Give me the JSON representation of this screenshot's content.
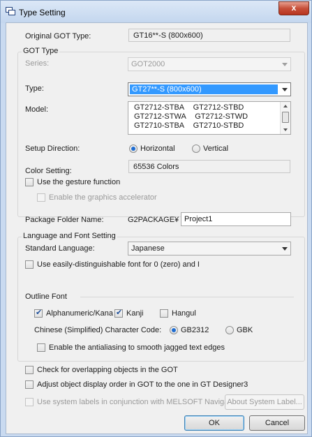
{
  "window": {
    "title": "Type Setting",
    "close_label": "x"
  },
  "original_got": {
    "label": "Original GOT Type:",
    "value": "GT16**-S (800x600)"
  },
  "got_type": {
    "group_label": "GOT Type",
    "series_label": "Series:",
    "series_value": "GOT2000",
    "type_label": "Type:",
    "type_value": "GT27**-S (800x600)",
    "model_label": "Model:",
    "models": [
      [
        "GT2712-STBA",
        "GT2712-STBD"
      ],
      [
        "GT2712-STWA",
        "GT2712-STWD"
      ],
      [
        "GT2710-STBA",
        "GT2710-STBD"
      ]
    ],
    "setup_direction_label": "Setup Direction:",
    "horizontal_label": "Horizontal",
    "vertical_label": "Vertical",
    "setup_direction_selected": "Horizontal",
    "color_label": "Color Setting:",
    "color_value": "65536 Colors",
    "gesture_label": "Use the gesture function",
    "gesture_checked": false,
    "graphics_accel_label": "Enable the graphics accelerator",
    "graphics_accel_checked": false
  },
  "package": {
    "label": "Package Folder Name:",
    "prefix": "G2PACKAGE¥",
    "value": "Project1"
  },
  "language": {
    "group_label": "Language and Font Setting",
    "standard_label": "Standard Language:",
    "standard_value": "Japanese",
    "distinguishable_label": "Use easily-distinguishable font for 0 (zero) and I",
    "distinguishable_checked": false,
    "outline_label": "Outline Font",
    "alphanumeric_label": "Alphanumeric/Kana",
    "alphanumeric_checked": true,
    "kanji_label": "Kanji",
    "kanji_checked": true,
    "hangul_label": "Hangul",
    "hangul_checked": false,
    "chinese_label": "Chinese (Simplified) Character Code:",
    "gb2312_label": "GB2312",
    "gbk_label": "GBK",
    "chinese_selected": "GB2312",
    "antialias_label": "Enable the antialiasing to smooth jagged text edges",
    "antialias_checked": false
  },
  "options": {
    "overlap_label": "Check for overlapping objects in the GOT",
    "adjust_order_label": "Adjust object display order in GOT to the one in GT Designer3",
    "system_labels_label": "Use system labels in conjunction with MELSOFT Navigator",
    "about_system_label_button": "About System Label..."
  },
  "buttons": {
    "ok": "OK",
    "cancel": "Cancel"
  },
  "colors": {
    "selection": "#3399ff",
    "title_bar": "#c9daf0",
    "close_button": "#c7503a"
  }
}
